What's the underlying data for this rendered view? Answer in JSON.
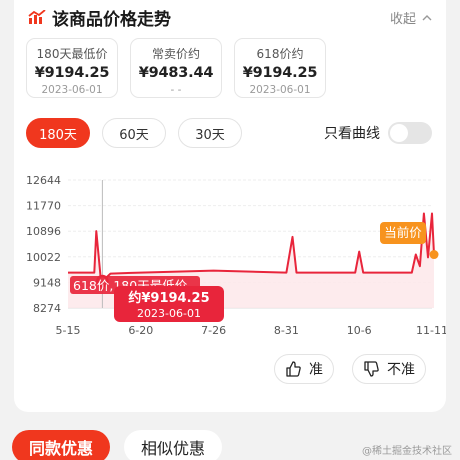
{
  "header": {
    "title": "该商品价格走势",
    "collapse_label": "收起"
  },
  "stats": [
    {
      "label": "180天最低价",
      "value": "¥9194.25",
      "date": "2023-06-01"
    },
    {
      "label": "常卖价约",
      "value": "¥9483.44",
      "date": "- -"
    },
    {
      "label": "618价约",
      "value": "¥9194.25",
      "date": "2023-06-01"
    }
  ],
  "ranges": [
    "180天",
    "60天",
    "30天"
  ],
  "active_range": "180天",
  "curve_only_label": "只看曲线",
  "tooltip": {
    "price": "约¥9194.25",
    "date": "2023-06-01"
  },
  "low_label": "618价,180天最低价",
  "current_label": "当前价",
  "feedback": {
    "like": "准",
    "dislike": "不准"
  },
  "bottom_tabs": [
    "同款优惠",
    "相似优惠"
  ],
  "watermark": "@稀土掘金技术社区",
  "colors": {
    "accent": "#f0371e",
    "line": "#e8253b",
    "current": "#f7931e"
  },
  "chart_data": {
    "type": "line",
    "yticks": [
      "12644",
      "11770",
      "10896",
      "10022",
      "9148",
      "8274"
    ],
    "xticks": [
      "5-15",
      "6-20",
      "7-26",
      "8-31",
      "10-6",
      "11-11"
    ],
    "ylim": [
      8274,
      12644
    ],
    "series": [
      {
        "points": [
          [
            "5-15",
            9483
          ],
          [
            "5-28",
            9483
          ],
          [
            "5-29",
            10900
          ],
          [
            "5-31",
            9400
          ],
          [
            "6-01",
            9194
          ],
          [
            "6-05",
            9450
          ],
          [
            "6-20",
            9483
          ],
          [
            "7-26",
            9550
          ],
          [
            "8-31",
            9483
          ],
          [
            "9-03",
            10700
          ],
          [
            "9-05",
            9483
          ],
          [
            "10-04",
            9483
          ],
          [
            "10-06",
            10200
          ],
          [
            "10-08",
            9483
          ],
          [
            "11-01",
            9483
          ],
          [
            "11-03",
            10100
          ],
          [
            "11-05",
            9700
          ],
          [
            "11-07",
            11500
          ],
          [
            "11-09",
            10000
          ],
          [
            "11-11",
            11500
          ],
          [
            "11-12",
            10100
          ]
        ]
      }
    ]
  }
}
